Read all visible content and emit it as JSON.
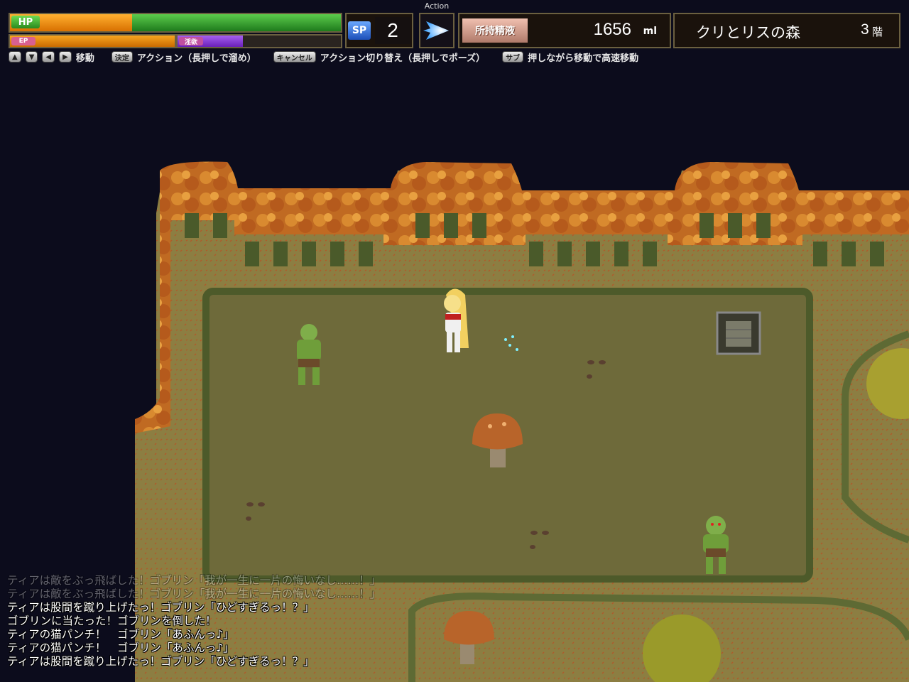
{
  "hud": {
    "hp_label": "HP",
    "hp_percent": 0.37,
    "ep_label": "EP",
    "lust_label": "淫欲",
    "lust_percent": 0.4,
    "sp_label": "SP",
    "sp_value": "2",
    "action_label": "Action",
    "semen_label": "所持精液",
    "semen_value": "1656",
    "semen_unit": "ml",
    "location_name": "クリとリスの森",
    "floor_number": "3",
    "floor_unit": "階"
  },
  "controls": {
    "move_label": "移動",
    "confirm_key": "決定",
    "confirm_label": "アクション（長押しで溜め）",
    "cancel_key": "キャンセル",
    "cancel_label": "アクション切り替え（長押しでポーズ）",
    "sub_key": "サブ",
    "sub_label": "押しながら移動で高速移動"
  },
  "log": [
    "ティアは敵をぶっ飛ばした！ゴブリン「我が一生に一片の悔いなし……！」",
    "ティアは敵をぶっ飛ばした！ゴブリン「我が一生に一片の悔いなし……！」",
    "ティアは股間を蹴り上げたっ！ゴブリン「ひどすぎるっ！？」",
    "ゴブリンに当たった！ゴブリンを倒した！",
    "ティアの猫パンチ！　ゴブリン「あふんっ♪」",
    "ティアの猫パンチ！　ゴブリン「あふんっ♪」",
    "ティアは股間を蹴り上げたっ！ゴブリン「ひどすぎるっ！？」"
  ],
  "colors": {
    "hp_fill": "#2f9a2c",
    "hp_damage": "#f08a10",
    "ep_fill": "#e88c10",
    "lust_fill": "#8a3ad8",
    "frame": "#6b6040",
    "grass": "#8a8040",
    "clearing": "#6e6a3a"
  }
}
